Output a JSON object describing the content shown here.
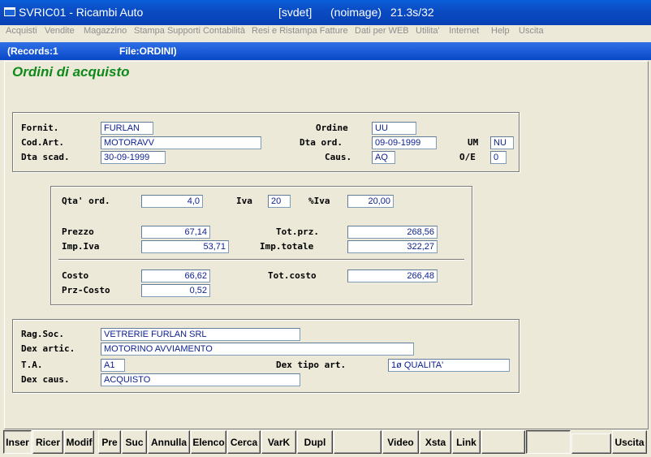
{
  "window": {
    "app_title": "SVRIC01 - Ricambi Auto",
    "module": "[svdet]",
    "image_state": "(noimage)",
    "version": "21.3s/32"
  },
  "menu": [
    "Acquisti",
    "Vendite",
    "Magazzino",
    "Stampa Supporti Contabilità",
    "Resi e Ristampa Fatture",
    "Dati per WEB",
    "Utilita'",
    "Internet",
    "Help",
    "Uscita"
  ],
  "header": {
    "records": "(Records:1",
    "file": "File:ORDINI)"
  },
  "form_title": "Ordini di acquisto",
  "order": {
    "fornit_label": "Fornit.",
    "fornit": "FURLAN",
    "ordine_label": "Ordine",
    "ordine": "UU",
    "codart_label": "Cod.Art.",
    "codart": "MOTORAVV",
    "dtaord_label": "Dta ord.",
    "dtaord": "09-09-1999",
    "um_label": "UM",
    "um": "NU",
    "dtascad_label": "Dta scad.",
    "dtascad": "30-09-1999",
    "caus_label": "Caus.",
    "caus": "AQ",
    "oe_label": "O/E",
    "oe": "0"
  },
  "amounts": {
    "qta_label": "Qta' ord.",
    "qta": "4,0",
    "iva_label": "Iva",
    "iva": "20",
    "piva_label": "%Iva",
    "piva": "20,00",
    "prezzo_label": "Prezzo",
    "prezzo": "67,14",
    "totprz_label": "Tot.prz.",
    "totprz": "268,56",
    "impiva_label": "Imp.Iva",
    "impiva": "53,71",
    "imptot_label": "Imp.totale",
    "imptot": "322,27",
    "costo_label": "Costo",
    "costo": "66,62",
    "totcosto_label": "Tot.costo",
    "totcosto": "266,48",
    "przcosto_label": "Prz-Costo",
    "przcosto": "0,52"
  },
  "details": {
    "ragsoc_label": "Rag.Soc.",
    "ragsoc": "VETRERIE FURLAN SRL",
    "dexartic_label": "Dex artic.",
    "dexartic": "MOTORINO AVVIAMENTO",
    "ta_label": "T.A.",
    "ta": "A1",
    "dextipo_label": "Dex tipo art.",
    "dextipo": "1ø QUALITA'",
    "dexcaus_label": "Dex caus.",
    "dexcaus": "ACQUISTO"
  },
  "buttons": [
    "Inser",
    "Ricer",
    "Modif",
    "Pre",
    "Suc",
    "Annulla",
    "Elenco",
    "Cerca",
    "VarK",
    "Dupl",
    "Video",
    "Xsta",
    "Link",
    "Uscita"
  ]
}
